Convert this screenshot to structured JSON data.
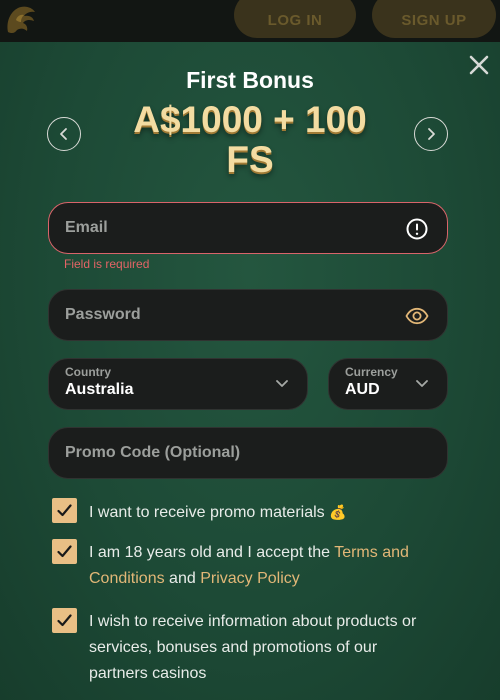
{
  "header": {
    "login_label": "LOG IN",
    "signup_label": "SIGN UP"
  },
  "bonus": {
    "title": "First Bonus",
    "amount_line1": "A$1000 + 100",
    "amount_line2": "FS"
  },
  "form": {
    "email": {
      "placeholder": "Email",
      "error": "Field is required"
    },
    "password": {
      "placeholder": "Password"
    },
    "country": {
      "label": "Country",
      "value": "Australia"
    },
    "currency": {
      "label": "Currency",
      "value": "AUD"
    },
    "promo": {
      "placeholder": "Promo Code (Optional)"
    }
  },
  "checkboxes": {
    "promo_materials": {
      "text": "I want to receive promo materials",
      "emoji": "💰",
      "checked": true
    },
    "age_terms": {
      "text_start": "I am 18 years old and I accept the ",
      "terms_link": "Terms and Conditions",
      "and": " and ",
      "privacy_link": "Privacy Policy",
      "checked": true
    },
    "partners": {
      "text": "I wish to receive information about products or services, bonuses and promotions of our partners casinos",
      "checked": true
    }
  },
  "colors": {
    "accent_gold": "#e9bf85",
    "link_gold": "#e2b777",
    "error_red": "#e36466",
    "modal_green": "#1d4a36"
  },
  "icons": {
    "logo": "lion-logo-icon",
    "close": "close-icon",
    "prev": "chevron-left-icon",
    "next": "chevron-right-icon",
    "error": "exclamation-circle-icon",
    "password": "eye-icon",
    "select": "chevron-down-icon",
    "check": "checkmark-icon"
  }
}
